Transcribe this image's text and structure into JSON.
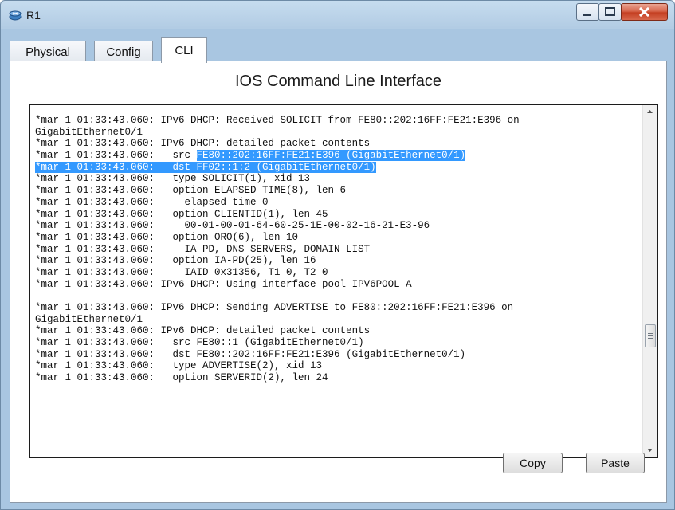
{
  "window": {
    "title": "R1"
  },
  "tabs": [
    {
      "label": "Physical",
      "selected": false
    },
    {
      "label": "Config",
      "selected": false
    },
    {
      "label": "CLI",
      "selected": true
    }
  ],
  "main": {
    "heading": "IOS Command Line Interface"
  },
  "console": {
    "lines": [
      "*mar 1 01:33:43.060: IPv6 DHCP: Received SOLICIT from FE80::202:16FF:FE21:E396 on",
      "GigabitEthernet0/1",
      "*mar 1 01:33:43.060: IPv6 DHCP: detailed packet contents",
      "*mar 1 01:33:43.060:   src FE80::202:16FF:FE21:E396 (GigabitEthernet0/1)",
      "*mar 1 01:33:43.060:   dst FF02::1:2 (GigabitEthernet0/1)",
      "*mar 1 01:33:43.060:   type SOLICIT(1), xid 13",
      "*mar 1 01:33:43.060:   option ELAPSED-TIME(8), len 6",
      "*mar 1 01:33:43.060:     elapsed-time 0",
      "*mar 1 01:33:43.060:   option CLIENTID(1), len 45",
      "*mar 1 01:33:43.060:     00-01-00-01-64-60-25-1E-00-02-16-21-E3-96",
      "*mar 1 01:33:43.060:   option ORO(6), len 10",
      "*mar 1 01:33:43.060:     IA-PD, DNS-SERVERS, DOMAIN-LIST",
      "*mar 1 01:33:43.060:   option IA-PD(25), len 16",
      "*mar 1 01:33:43.060:     IAID 0x31356, T1 0, T2 0",
      "*mar 1 01:33:43.060: IPv6 DHCP: Using interface pool IPV6POOL-A",
      "",
      "*mar 1 01:33:43.060: IPv6 DHCP: Sending ADVERTISE to FE80::202:16FF:FE21:E396 on",
      "GigabitEthernet0/1",
      "*mar 1 01:33:43.060: IPv6 DHCP: detailed packet contents",
      "*mar 1 01:33:43.060:   src FE80::1 (GigabitEthernet0/1)",
      "*mar 1 01:33:43.060:   dst FE80::202:16FF:FE21:E396 (GigabitEthernet0/1)",
      "*mar 1 01:33:43.060:   type ADVERTISE(2), xid 13",
      "*mar 1 01:33:43.060:   option SERVERID(2), len 24"
    ],
    "selection": [
      {
        "line": 3,
        "start": 27
      },
      {
        "line": 4,
        "start": 0
      }
    ]
  },
  "buttons": {
    "copy": "Copy",
    "paste": "Paste"
  },
  "colors": {
    "selection": "#3399ff",
    "window_frame": "#a9c6e1",
    "close_button": "#c43f22"
  }
}
